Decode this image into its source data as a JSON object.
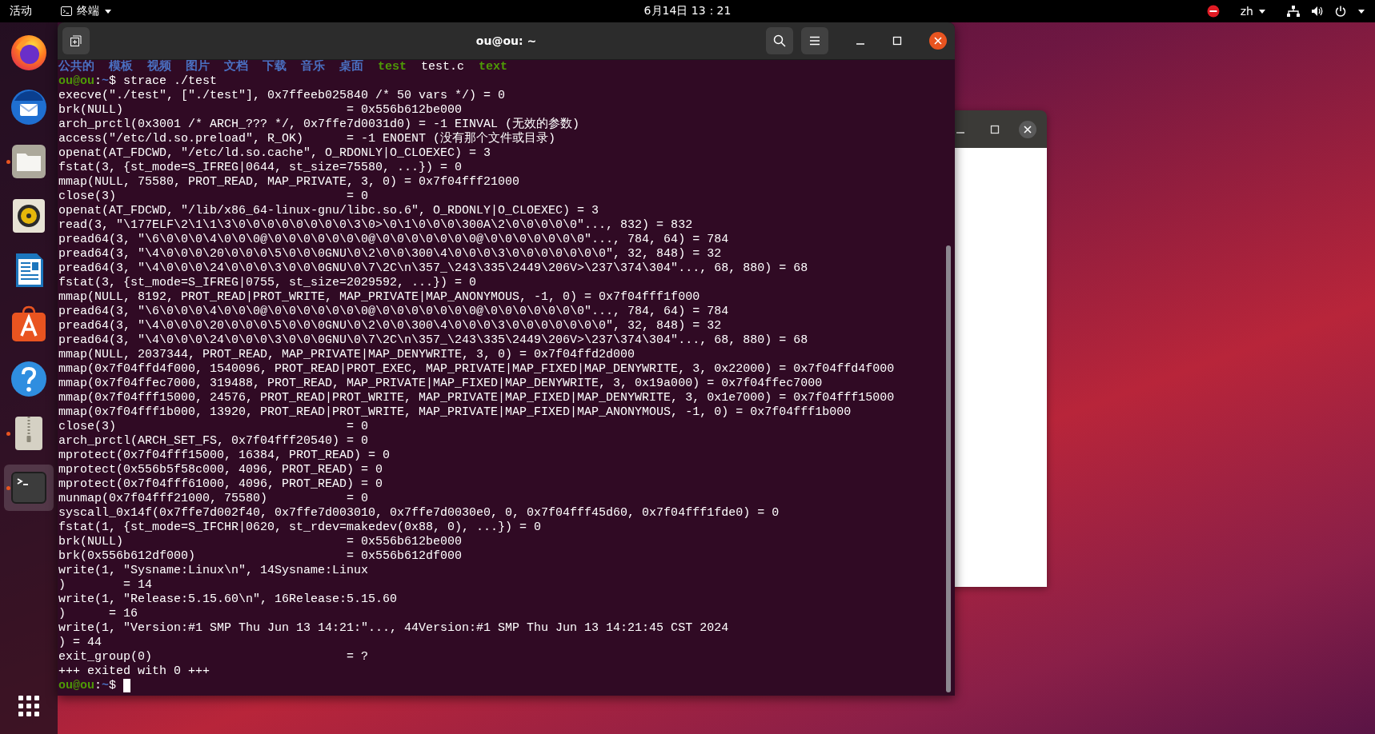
{
  "top_bar": {
    "activities": "活动",
    "app_menu": "终端",
    "clock": "6月14日 13：21",
    "input_method": "zh"
  },
  "dock": [
    {
      "running": false,
      "selected": false
    },
    {
      "running": false,
      "selected": false
    },
    {
      "running": true,
      "selected": false
    },
    {
      "running": false,
      "selected": false
    },
    {
      "running": false,
      "selected": false
    },
    {
      "running": false,
      "selected": false
    },
    {
      "running": false,
      "selected": false
    },
    {
      "running": true,
      "selected": false
    },
    {
      "running": true,
      "selected": true
    }
  ],
  "terminal": {
    "title": "ou@ou: ~",
    "lines": [
      {
        "kind": "ls",
        "items": [
          {
            "text": "公共的",
            "kind": "dir"
          },
          {
            "text": "模板",
            "kind": "dir"
          },
          {
            "text": "视频",
            "kind": "dir"
          },
          {
            "text": "图片",
            "kind": "dir"
          },
          {
            "text": "文档",
            "kind": "dir"
          },
          {
            "text": "下载",
            "kind": "dir"
          },
          {
            "text": "音乐",
            "kind": "dir"
          },
          {
            "text": "桌面",
            "kind": "dir"
          },
          {
            "text": "test",
            "kind": "exec"
          },
          {
            "text": "test.c",
            "kind": "file"
          },
          {
            "text": "text",
            "kind": "exec"
          }
        ]
      },
      {
        "kind": "prompt",
        "user": "ou@ou",
        "sep": ":",
        "path": "~",
        "symbol": "$",
        "command": "strace ./test",
        "cursor": false
      },
      {
        "kind": "out",
        "text": "execve(\"./test\", [\"./test\"], 0x7ffeeb025840 /* 50 vars */) = 0"
      },
      {
        "kind": "out",
        "text": "brk(NULL)                               = 0x556b612be000"
      },
      {
        "kind": "out",
        "text": "arch_prctl(0x3001 /* ARCH_??? */, 0x7ffe7d0031d0) = -1 EINVAL (无效的参数)"
      },
      {
        "kind": "out",
        "text": "access(\"/etc/ld.so.preload\", R_OK)      = -1 ENOENT (没有那个文件或目录)"
      },
      {
        "kind": "out",
        "text": "openat(AT_FDCWD, \"/etc/ld.so.cache\", O_RDONLY|O_CLOEXEC) = 3"
      },
      {
        "kind": "out",
        "text": "fstat(3, {st_mode=S_IFREG|0644, st_size=75580, ...}) = 0"
      },
      {
        "kind": "out",
        "text": "mmap(NULL, 75580, PROT_READ, MAP_PRIVATE, 3, 0) = 0x7f04fff21000"
      },
      {
        "kind": "out",
        "text": "close(3)                                = 0"
      },
      {
        "kind": "out",
        "text": "openat(AT_FDCWD, \"/lib/x86_64-linux-gnu/libc.so.6\", O_RDONLY|O_CLOEXEC) = 3"
      },
      {
        "kind": "out",
        "text": "read(3, \"\\177ELF\\2\\1\\1\\3\\0\\0\\0\\0\\0\\0\\0\\0\\3\\0>\\0\\1\\0\\0\\0\\300A\\2\\0\\0\\0\\0\\0\"..., 832) = 832"
      },
      {
        "kind": "out",
        "text": "pread64(3, \"\\6\\0\\0\\0\\4\\0\\0\\0@\\0\\0\\0\\0\\0\\0\\0@\\0\\0\\0\\0\\0\\0\\0@\\0\\0\\0\\0\\0\\0\\0\"..., 784, 64) = 784"
      },
      {
        "kind": "out",
        "text": "pread64(3, \"\\4\\0\\0\\0\\20\\0\\0\\0\\5\\0\\0\\0GNU\\0\\2\\0\\0\\300\\4\\0\\0\\0\\3\\0\\0\\0\\0\\0\\0\\0\", 32, 848) = 32"
      },
      {
        "kind": "out",
        "text": "pread64(3, \"\\4\\0\\0\\0\\24\\0\\0\\0\\3\\0\\0\\0GNU\\0\\7\\2C\\n\\357_\\243\\335\\2449\\206V>\\237\\374\\304\"..., 68, 880) = 68"
      },
      {
        "kind": "out",
        "text": "fstat(3, {st_mode=S_IFREG|0755, st_size=2029592, ...}) = 0"
      },
      {
        "kind": "out",
        "text": "mmap(NULL, 8192, PROT_READ|PROT_WRITE, MAP_PRIVATE|MAP_ANONYMOUS, -1, 0) = 0x7f04fff1f000"
      },
      {
        "kind": "out",
        "text": "pread64(3, \"\\6\\0\\0\\0\\4\\0\\0\\0@\\0\\0\\0\\0\\0\\0\\0@\\0\\0\\0\\0\\0\\0\\0@\\0\\0\\0\\0\\0\\0\\0\"..., 784, 64) = 784"
      },
      {
        "kind": "out",
        "text": "pread64(3, \"\\4\\0\\0\\0\\20\\0\\0\\0\\5\\0\\0\\0GNU\\0\\2\\0\\0\\300\\4\\0\\0\\0\\3\\0\\0\\0\\0\\0\\0\\0\", 32, 848) = 32"
      },
      {
        "kind": "out",
        "text": "pread64(3, \"\\4\\0\\0\\0\\24\\0\\0\\0\\3\\0\\0\\0GNU\\0\\7\\2C\\n\\357_\\243\\335\\2449\\206V>\\237\\374\\304\"..., 68, 880) = 68"
      },
      {
        "kind": "out",
        "text": "mmap(NULL, 2037344, PROT_READ, MAP_PRIVATE|MAP_DENYWRITE, 3, 0) = 0x7f04ffd2d000"
      },
      {
        "kind": "out",
        "text": "mmap(0x7f04ffd4f000, 1540096, PROT_READ|PROT_EXEC, MAP_PRIVATE|MAP_FIXED|MAP_DENYWRITE, 3, 0x22000) = 0x7f04ffd4f000"
      },
      {
        "kind": "out",
        "text": "mmap(0x7f04ffec7000, 319488, PROT_READ, MAP_PRIVATE|MAP_FIXED|MAP_DENYWRITE, 3, 0x19a000) = 0x7f04ffec7000"
      },
      {
        "kind": "out",
        "text": "mmap(0x7f04fff15000, 24576, PROT_READ|PROT_WRITE, MAP_PRIVATE|MAP_FIXED|MAP_DENYWRITE, 3, 0x1e7000) = 0x7f04fff15000"
      },
      {
        "kind": "out",
        "text": "mmap(0x7f04fff1b000, 13920, PROT_READ|PROT_WRITE, MAP_PRIVATE|MAP_FIXED|MAP_ANONYMOUS, -1, 0) = 0x7f04fff1b000"
      },
      {
        "kind": "out",
        "text": "close(3)                                = 0"
      },
      {
        "kind": "out",
        "text": "arch_prctl(ARCH_SET_FS, 0x7f04fff20540) = 0"
      },
      {
        "kind": "out",
        "text": "mprotect(0x7f04fff15000, 16384, PROT_READ) = 0"
      },
      {
        "kind": "out",
        "text": "mprotect(0x556b5f58c000, 4096, PROT_READ) = 0"
      },
      {
        "kind": "out",
        "text": "mprotect(0x7f04fff61000, 4096, PROT_READ) = 0"
      },
      {
        "kind": "out",
        "text": "munmap(0x7f04fff21000, 75580)           = 0"
      },
      {
        "kind": "out",
        "text": "syscall_0x14f(0x7ffe7d002f40, 0x7ffe7d003010, 0x7ffe7d0030e0, 0, 0x7f04fff45d60, 0x7f04fff1fde0) = 0"
      },
      {
        "kind": "out",
        "text": "fstat(1, {st_mode=S_IFCHR|0620, st_rdev=makedev(0x88, 0), ...}) = 0"
      },
      {
        "kind": "out",
        "text": "brk(NULL)                               = 0x556b612be000"
      },
      {
        "kind": "out",
        "text": "brk(0x556b612df000)                     = 0x556b612df000"
      },
      {
        "kind": "out",
        "text": "write(1, \"Sysname:Linux\\n\", 14Sysname:Linux"
      },
      {
        "kind": "out",
        "text": ")        = 14"
      },
      {
        "kind": "out",
        "text": "write(1, \"Release:5.15.60\\n\", 16Release:5.15.60"
      },
      {
        "kind": "out",
        "text": ")      = 16"
      },
      {
        "kind": "out",
        "text": "write(1, \"Version:#1 SMP Thu Jun 13 14:21:\"..., 44Version:#1 SMP Thu Jun 13 14:21:45 CST 2024"
      },
      {
        "kind": "out",
        "text": ") = 44"
      },
      {
        "kind": "out",
        "text": "exit_group(0)                           = ?"
      },
      {
        "kind": "out",
        "text": "+++ exited with 0 +++"
      },
      {
        "kind": "prompt",
        "user": "ou@ou",
        "sep": ":",
        "path": "~",
        "symbol": "$",
        "cursor": true
      }
    ]
  }
}
